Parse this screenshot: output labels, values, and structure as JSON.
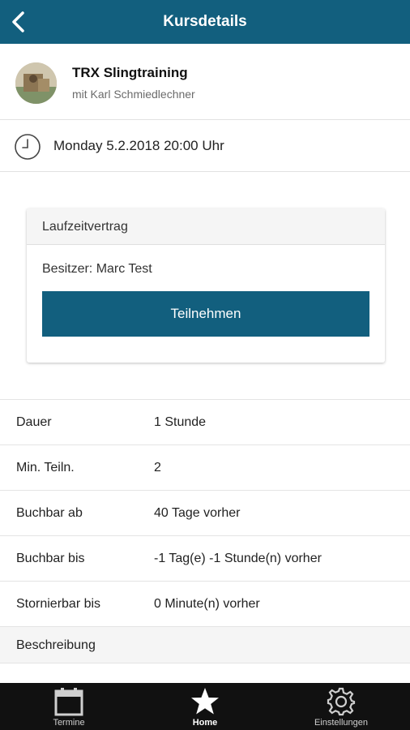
{
  "header": {
    "title": "Kursdetails",
    "back_icon": "chevron-left-icon",
    "color": "#125f7e"
  },
  "course": {
    "name": "TRX Slingtraining",
    "trainer": "mit Karl Schmiedlechner"
  },
  "schedule": {
    "datetime": "Monday 5.2.2018 20:00 Uhr",
    "icon": "clock-icon"
  },
  "contract": {
    "title": "Laufzeitvertrag",
    "owner": "Besitzer: Marc Test",
    "button_label": "Teilnehmen"
  },
  "details": [
    {
      "label": "Dauer",
      "value": "1 Stunde"
    },
    {
      "label": "Min. Teiln.",
      "value": "2"
    },
    {
      "label": "Buchbar ab",
      "value": "40 Tage vorher"
    },
    {
      "label": "Buchbar bis",
      "value": "-1 Tag(e) -1 Stunde(n) vorher"
    },
    {
      "label": "Stornierbar bis",
      "value": "0 Minute(n) vorher"
    }
  ],
  "description": {
    "label": "Beschreibung"
  },
  "tabbar": {
    "tabs": [
      {
        "label": "Termine",
        "icon": "calendar-icon"
      },
      {
        "label": "Home",
        "icon": "star-icon",
        "active": true
      },
      {
        "label": "Einstellungen",
        "icon": "gear-icon"
      }
    ]
  }
}
